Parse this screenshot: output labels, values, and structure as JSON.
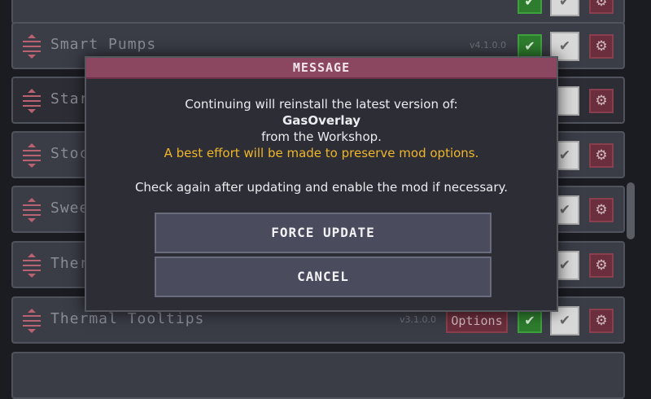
{
  "mod_list": {
    "rows": [
      {
        "title": "",
        "version": "",
        "options_label": "",
        "check": "✔",
        "box": "✔",
        "gear": "⚙"
      },
      {
        "title": "Smart Pumps",
        "version": "v4.1.0.0",
        "options_label": "",
        "check": "✔",
        "box": "✔",
        "gear": "⚙"
      },
      {
        "title": "Starm",
        "version": "",
        "options_label": "",
        "check": "",
        "box": "",
        "gear": "⚙"
      },
      {
        "title": "Stock",
        "version": "",
        "options_label": "",
        "check": "",
        "box": "✔",
        "gear": "⚙"
      },
      {
        "title": "Swee",
        "version": "",
        "options_label": "",
        "check": "",
        "box": "✔",
        "gear": "⚙"
      },
      {
        "title": "Therm",
        "version": "",
        "options_label": "",
        "check": "",
        "box": "✔",
        "gear": "⚙"
      },
      {
        "title": "Thermal Tooltips",
        "version": "v3.1.0.0",
        "options_label": "Options",
        "check": "✔",
        "box": "✔",
        "gear": "⚙"
      }
    ]
  },
  "dialog": {
    "header": "MESSAGE",
    "line1": "Continuing will reinstall the latest version of:",
    "mod_name": "GasOverlay",
    "line3": "from the Workshop.",
    "warning": "A best effort will be made to preserve mod options.",
    "check_again": "Check again after updating and enable the mod if necessary.",
    "force_update_label": "FORCE UPDATE",
    "cancel_label": "CANCEL"
  }
}
